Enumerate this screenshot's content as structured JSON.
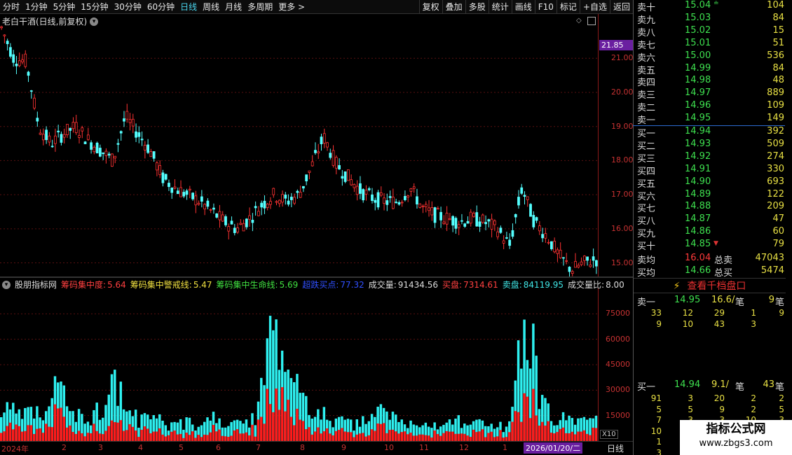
{
  "toolbar": {
    "left_items": [
      "分时",
      "1分钟",
      "5分钟",
      "15分钟",
      "30分钟",
      "60分钟",
      "日线",
      "周线",
      "月线",
      "多周期",
      "更多 >"
    ],
    "active_item": "日线",
    "right_items": [
      "复权",
      "叠加",
      "多股",
      "统计",
      "画线",
      "F10",
      "标记",
      "+自选",
      "返回"
    ]
  },
  "chart": {
    "title": "老白干酒(日线,前复权)",
    "current_price_label": "21.85",
    "price_ticks": [
      "21.00",
      "20.00",
      "19.00",
      "18.00",
      "17.00",
      "16.00",
      "15.00"
    ]
  },
  "indicator": {
    "name": "股朋指标网",
    "items": [
      {
        "label": "筹码集中度:",
        "value": "5.64",
        "color": "#ff4040"
      },
      {
        "label": "筹码集中警戒线:",
        "value": "5.47",
        "color": "#f0e040"
      },
      {
        "label": "筹码集中生命线:",
        "value": "5.69",
        "color": "#40e040"
      },
      {
        "label": "超跌买点:",
        "value": "77.32",
        "color": "#3050ff"
      },
      {
        "label": "成交量:",
        "value": "91434.56",
        "color": "#dddddd"
      },
      {
        "label": "买盘:",
        "value": "7314.61",
        "color": "#ff4040"
      },
      {
        "label": "卖盘:",
        "value": "84119.95",
        "color": "#40e8e8"
      },
      {
        "label": "成交量比:",
        "value": "8.00",
        "color": "#dddddd"
      }
    ],
    "vol_ticks": [
      "75000",
      "60000",
      "45000",
      "30000",
      "15000"
    ],
    "x10_label": "X10"
  },
  "dates": {
    "labels": [
      "2024年",
      "2",
      "3",
      "4",
      "5",
      "6",
      "7",
      "8",
      "9",
      "10",
      "11",
      "12",
      "1"
    ],
    "highlight": "2026/01/20/二",
    "period": "日线"
  },
  "chart_data": {
    "type": "candlestick",
    "title": "老白干酒(日线,前复权)",
    "ylim": [
      14.6,
      22.3
    ],
    "y_ticks": [
      15,
      16,
      17,
      18,
      19,
      20,
      21
    ],
    "current_price": 21.85,
    "x_labels": [
      "2024年",
      "2",
      "3",
      "4",
      "5",
      "6",
      "7",
      "8",
      "9",
      "10",
      "11",
      "12",
      "1"
    ],
    "price_path": [
      21.9,
      21.0,
      20.9,
      19.0,
      18.5,
      18.8,
      19.0,
      18.6,
      18.3,
      18.0,
      19.3,
      18.8,
      18.3,
      17.5,
      17.2,
      17.0,
      16.8,
      16.5,
      16.2,
      16.0,
      16.3,
      16.7,
      17.0,
      16.8,
      17.0,
      17.8,
      18.7,
      17.9,
      17.5,
      17.1,
      16.9,
      16.8,
      16.8,
      17.2,
      16.6,
      16.4,
      16.3,
      16.2,
      16.3,
      16.2,
      16.0,
      15.5,
      17.2,
      16.2,
      15.8,
      15.2,
      14.8,
      15.0,
      15.1
    ],
    "volume_ticks": [
      15000,
      30000,
      45000,
      60000,
      75000
    ],
    "volume_path": [
      22000,
      17000,
      14000,
      20000,
      32000,
      15000,
      14000,
      18000,
      40000,
      15000,
      12000,
      14000,
      9000,
      11000,
      8000,
      13000,
      10000,
      9000,
      15000,
      60000,
      45000,
      28000,
      18000,
      14000,
      11000,
      9000,
      12000,
      20000,
      10000,
      9000,
      11000,
      8000,
      13000,
      9000,
      10000,
      8000,
      9000,
      85000,
      24000,
      15000,
      12000,
      10000,
      12000
    ]
  },
  "orderbook": {
    "asks": [
      {
        "label": "卖十",
        "price": "15.04",
        "vol": "104"
      },
      {
        "label": "卖九",
        "price": "15.03",
        "vol": "84"
      },
      {
        "label": "卖八",
        "price": "15.02",
        "vol": "15"
      },
      {
        "label": "卖七",
        "price": "15.01",
        "vol": "51"
      },
      {
        "label": "卖六",
        "price": "15.00",
        "vol": "536"
      },
      {
        "label": "卖五",
        "price": "14.99",
        "vol": "84"
      },
      {
        "label": "卖四",
        "price": "14.98",
        "vol": "48"
      },
      {
        "label": "卖三",
        "price": "14.97",
        "vol": "889"
      },
      {
        "label": "卖二",
        "price": "14.96",
        "vol": "109"
      },
      {
        "label": "卖一",
        "price": "14.95",
        "vol": "149"
      }
    ],
    "bids": [
      {
        "label": "买一",
        "price": "14.94",
        "vol": "392"
      },
      {
        "label": "买二",
        "price": "14.93",
        "vol": "509"
      },
      {
        "label": "买三",
        "price": "14.92",
        "vol": "274"
      },
      {
        "label": "买四",
        "price": "14.91",
        "vol": "330"
      },
      {
        "label": "买五",
        "price": "14.90",
        "vol": "693"
      },
      {
        "label": "买六",
        "price": "14.89",
        "vol": "122"
      },
      {
        "label": "买七",
        "price": "14.88",
        "vol": "209"
      },
      {
        "label": "买八",
        "price": "14.87",
        "vol": "47"
      },
      {
        "label": "买九",
        "price": "14.86",
        "vol": "60"
      },
      {
        "label": "买十",
        "price": "14.85",
        "vol": "79"
      }
    ],
    "sell_avg": {
      "label": "卖均",
      "price": "16.04",
      "total_label": "总卖",
      "total": "47043"
    },
    "buy_avg": {
      "label": "买均",
      "price": "14.66",
      "total_label": "总买",
      "total": "5474"
    }
  },
  "qlink": {
    "text": "查看千档盘口"
  },
  "ask1_detail": {
    "label": "卖一",
    "price": "14.95",
    "avg": "16.6/",
    "unit": "笔",
    "count": "9",
    "count_unit": "笔"
  },
  "ask1_rows": [
    [
      "33",
      "12",
      "29",
      "1",
      "9"
    ],
    [
      "9",
      "10",
      "43",
      "3",
      ""
    ]
  ],
  "bid1_detail": {
    "label": "买一",
    "price": "14.94",
    "avg": "9.1/",
    "unit": "笔",
    "count": "43",
    "count_unit": "笔"
  },
  "bid1_rows": [
    [
      "91",
      "3",
      "20",
      "2",
      "2"
    ],
    [
      "5",
      "5",
      "9",
      "2",
      "5"
    ],
    [
      "7",
      "3",
      "3",
      "10",
      "3"
    ],
    [
      "10",
      "",
      "",
      "",
      ""
    ],
    [
      "1",
      "",
      "",
      "",
      ""
    ],
    [
      "3",
      "",
      "",
      "",
      ""
    ]
  ],
  "side_strip": [
    "",
    ""
  ],
  "watermark": {
    "title": "指标公式网",
    "url": "www.zbgs3.com"
  }
}
